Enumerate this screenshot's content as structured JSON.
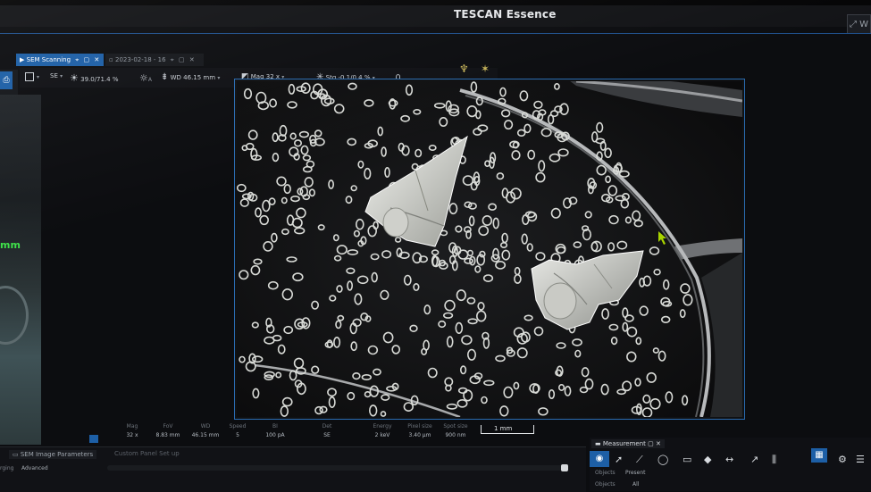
{
  "window": {
    "title": "TESCAN Essence"
  },
  "tabs": [
    {
      "label": "SEM Scanning",
      "active": true
    },
    {
      "label": "2023-02-18 - 16",
      "active": false
    }
  ],
  "preview": {
    "unit_text": "mm"
  },
  "toolbar": {
    "detector": "SE",
    "brightness_contrast": "39.0/71.4 %",
    "wd": "WD 46.15 mm",
    "mag": "Mag 32 x",
    "stigmator": "Stg -0.1/0.4 %"
  },
  "info_bar": [
    {
      "label": "Mag",
      "value": "32 x"
    },
    {
      "label": "FoV",
      "value": "8.83 mm"
    },
    {
      "label": "WD",
      "value": "46.15 mm"
    },
    {
      "label": "Speed",
      "value": "5"
    },
    {
      "label": "BI",
      "value": "100 pA"
    },
    {
      "label": "Det",
      "value": "SE"
    },
    {
      "label": "Energy",
      "value": "2 keV"
    },
    {
      "label": "Pixel size",
      "value": "3.40 µm"
    },
    {
      "label": "Spot size",
      "value": "900 nm"
    }
  ],
  "scalebar": {
    "label": "1 mm"
  },
  "bottom_panel": {
    "tab_1": "SEM Image Parameters",
    "tab_2": "Custom Panel Set up",
    "row_label": "rging",
    "row_value": "Advanced"
  },
  "measurement_panel": {
    "tab": "Measurement",
    "row1_label": "Objects",
    "row1_value": "Present",
    "row2_label": "Objects",
    "row2_value": "All"
  },
  "colors": {
    "accent": "#1d5fa6",
    "frame": "#2a6bb0",
    "cursor": "#a8d400"
  },
  "icons": [
    "eye-icon",
    "pointer-icon",
    "polyline-icon",
    "ellipse-icon",
    "rectangle-icon",
    "fill-icon",
    "distance-icon",
    "arrow-icon",
    "grid-icon",
    "gear-icon"
  ]
}
